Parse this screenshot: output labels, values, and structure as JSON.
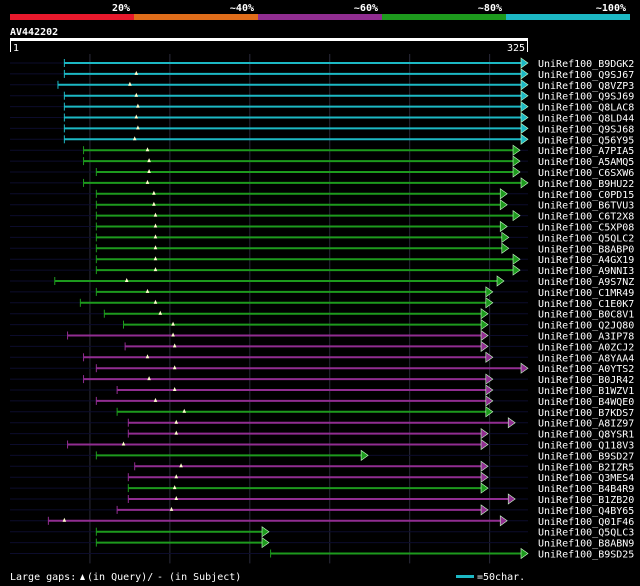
{
  "query_id": "AV442202",
  "ruler": {
    "start_label": "1",
    "end_label": "325"
  },
  "legend": {
    "identity": [
      {
        "label": "20%",
        "color": "#e8192c"
      },
      {
        "label": "~40%",
        "color": "#e06d1a"
      },
      {
        "label": "~60%",
        "color": "#912d91"
      },
      {
        "label": "~80%",
        "color": "#1d9a1d"
      },
      {
        "label": "~100%",
        "color": "#1cb8c4"
      }
    ]
  },
  "footer": {
    "gaps_text": "Large gaps: ",
    "in_query_text": "(in Query)/",
    "in_subject_text": "- (in Subject)",
    "scale_text": "=50char."
  },
  "chart_data": {
    "type": "alignment",
    "x_range": [
      1,
      325
    ],
    "hits": [
      {
        "name": "UniRef100_B9DGK2",
        "identity_band": "~100%",
        "start": 35,
        "end": 325,
        "arrow": "right",
        "marker": null
      },
      {
        "name": "UniRef100_Q9SJ67",
        "identity_band": "~100%",
        "start": 35,
        "end": 325,
        "arrow": "right",
        "marker": 80
      },
      {
        "name": "UniRef100_Q8VZP3",
        "identity_band": "~100%",
        "start": 31,
        "end": 325,
        "arrow": "right",
        "marker": 76
      },
      {
        "name": "UniRef100_Q9SJ69",
        "identity_band": "~100%",
        "start": 35,
        "end": 325,
        "arrow": "right",
        "marker": 80
      },
      {
        "name": "UniRef100_Q8LAC8",
        "identity_band": "~100%",
        "start": 35,
        "end": 325,
        "arrow": "right",
        "marker": 81
      },
      {
        "name": "UniRef100_Q8LD44",
        "identity_band": "~100%",
        "start": 35,
        "end": 325,
        "arrow": "right",
        "marker": 80
      },
      {
        "name": "UniRef100_Q9SJ68",
        "identity_band": "~100%",
        "start": 35,
        "end": 325,
        "arrow": "right",
        "marker": 81
      },
      {
        "name": "UniRef100_Q56Y95",
        "identity_band": "~100%",
        "start": 35,
        "end": 325,
        "arrow": "right",
        "marker": 79
      },
      {
        "name": "UniRef100_A7PIA5",
        "identity_band": "~80%",
        "start": 47,
        "end": 320,
        "arrow": "right",
        "marker": 87
      },
      {
        "name": "UniRef100_A5AMQ5",
        "identity_band": "~80%",
        "start": 47,
        "end": 320,
        "arrow": "right",
        "marker": 88
      },
      {
        "name": "UniRef100_C6SXW6",
        "identity_band": "~80%",
        "start": 55,
        "end": 320,
        "arrow": "right",
        "marker": 88
      },
      {
        "name": "UniRef100_B9HU22",
        "identity_band": "~80%",
        "start": 47,
        "end": 325,
        "arrow": "right",
        "marker": 87
      },
      {
        "name": "UniRef100_C0PD15",
        "identity_band": "~80%",
        "start": 55,
        "end": 312,
        "arrow": "right",
        "marker": 91
      },
      {
        "name": "UniRef100_B6TVU3",
        "identity_band": "~80%",
        "start": 55,
        "end": 312,
        "arrow": "right",
        "marker": 91
      },
      {
        "name": "UniRef100_C6T2X8",
        "identity_band": "~80%",
        "start": 55,
        "end": 320,
        "arrow": "right",
        "marker": 92
      },
      {
        "name": "UniRef100_C5XP08",
        "identity_band": "~80%",
        "start": 55,
        "end": 312,
        "arrow": "right",
        "marker": 92
      },
      {
        "name": "UniRef100_Q5QLC2",
        "identity_band": "~80%",
        "start": 55,
        "end": 313,
        "arrow": "right",
        "marker": 92
      },
      {
        "name": "UniRef100_B8ABP0",
        "identity_band": "~80%",
        "start": 55,
        "end": 313,
        "arrow": "right",
        "marker": 92
      },
      {
        "name": "UniRef100_A4GX19",
        "identity_band": "~80%",
        "start": 55,
        "end": 320,
        "arrow": "right",
        "marker": 92
      },
      {
        "name": "UniRef100_A9NNI3",
        "identity_band": "~80%",
        "start": 55,
        "end": 320,
        "arrow": "right",
        "marker": 92
      },
      {
        "name": "UniRef100_A9S7NZ",
        "identity_band": "~80%",
        "start": 29,
        "end": 310,
        "arrow": "right",
        "marker": 74
      },
      {
        "name": "UniRef100_C1MR49",
        "identity_band": "~80%",
        "start": 55,
        "end": 303,
        "arrow": "right",
        "marker": 87
      },
      {
        "name": "UniRef100_C1E0K7",
        "identity_band": "~80%",
        "start": 45,
        "end": 303,
        "arrow": "right",
        "marker": 92
      },
      {
        "name": "UniRef100_B0C8V1",
        "identity_band": "~80%",
        "start": 60,
        "end": 300,
        "arrow": "right",
        "marker": 95
      },
      {
        "name": "UniRef100_Q2JQ80",
        "identity_band": "~80%",
        "start": 72,
        "end": 300,
        "arrow": "right",
        "marker": 103
      },
      {
        "name": "UniRef100_A3IP78",
        "identity_band": "~60%",
        "start": 37,
        "end": 300,
        "arrow": "right",
        "marker": 103
      },
      {
        "name": "UniRef100_A0ZCJ2",
        "identity_band": "~60%",
        "start": 73,
        "end": 300,
        "arrow": "right",
        "marker": 104
      },
      {
        "name": "UniRef100_A8YAA4",
        "identity_band": "~60%",
        "start": 47,
        "end": 303,
        "arrow": "right",
        "marker": 87
      },
      {
        "name": "UniRef100_A0YTS2",
        "identity_band": "~60%",
        "start": 55,
        "end": 325,
        "arrow": "right",
        "marker": 104
      },
      {
        "name": "UniRef100_B0JR42",
        "identity_band": "~60%",
        "start": 47,
        "end": 303,
        "arrow": "right",
        "marker": 88
      },
      {
        "name": "UniRef100_B1WZV1",
        "identity_band": "~60%",
        "start": 68,
        "end": 303,
        "arrow": "right",
        "marker": 104
      },
      {
        "name": "UniRef100_B4WQE0",
        "identity_band": "~60%",
        "start": 55,
        "end": 303,
        "arrow": "right",
        "marker": 92
      },
      {
        "name": "UniRef100_B7KDS7",
        "identity_band": "~80%",
        "start": 68,
        "end": 303,
        "arrow": "right",
        "marker": 110
      },
      {
        "name": "UniRef100_A8IZ97",
        "identity_band": "~60%",
        "start": 75,
        "end": 317,
        "arrow": "right",
        "marker": 105
      },
      {
        "name": "UniRef100_Q8YSR1",
        "identity_band": "~60%",
        "start": 75,
        "end": 300,
        "arrow": "right",
        "marker": 105
      },
      {
        "name": "UniRef100_Q118V3",
        "identity_band": "~60%",
        "start": 37,
        "end": 300,
        "arrow": "right",
        "marker": 72
      },
      {
        "name": "UniRef100_B9SD27",
        "identity_band": "~80%",
        "start": 55,
        "end": 225,
        "arrow": "right",
        "marker": null
      },
      {
        "name": "UniRef100_B2IZR5",
        "identity_band": "~60%",
        "start": 79,
        "end": 300,
        "arrow": "right",
        "marker": 108
      },
      {
        "name": "UniRef100_Q3MES4",
        "identity_band": "~60%",
        "start": 75,
        "end": 300,
        "arrow": "right",
        "marker": 105
      },
      {
        "name": "UniRef100_B4B4R9",
        "identity_band": "~80%",
        "start": 75,
        "end": 300,
        "arrow": "right",
        "marker": 104
      },
      {
        "name": "UniRef100_B1ZB20",
        "identity_band": "~60%",
        "start": 75,
        "end": 317,
        "arrow": "right",
        "marker": 105
      },
      {
        "name": "UniRef100_Q4BY65",
        "identity_band": "~60%",
        "start": 68,
        "end": 300,
        "arrow": "right",
        "marker": 102
      },
      {
        "name": "UniRef100_Q01F46",
        "identity_band": "~60%",
        "start": 25,
        "end": 312,
        "arrow": "right",
        "marker": 35
      },
      {
        "name": "UniRef100_Q5QLC3",
        "identity_band": "~80%",
        "start": 55,
        "end": 163,
        "arrow": "right",
        "marker": null
      },
      {
        "name": "UniRef100_B8ABN9",
        "identity_band": "~80%",
        "start": 55,
        "end": 163,
        "arrow": "right",
        "marker": null
      },
      {
        "name": "UniRef100_B9SD25",
        "identity_band": "~80%",
        "start": 164,
        "end": 325,
        "arrow": "right",
        "marker": null
      }
    ]
  }
}
